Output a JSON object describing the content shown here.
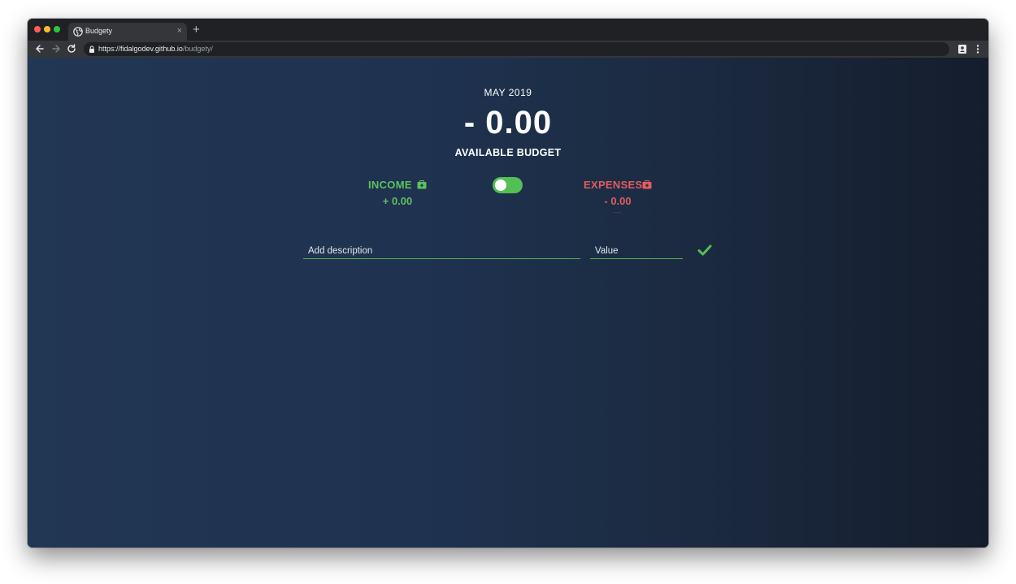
{
  "browser": {
    "tab_title": "Budgety",
    "tab_close": "×",
    "new_tab": "+",
    "url_host": "https://fidalgodev.github.io",
    "url_path": "/budgety/"
  },
  "budget": {
    "month": "MAY 2019",
    "available_value": "- 0.00",
    "available_label": "AVAILABLE BUDGET"
  },
  "income": {
    "title": "INCOME",
    "value": "+ 0.00",
    "color": "#5cc25e"
  },
  "expenses": {
    "title": "EXPENSES",
    "value": "- 0.00",
    "percentage": "---",
    "color": "#e05d5d"
  },
  "toggle": {
    "state": "on",
    "color": "#53bf55"
  },
  "form": {
    "description_placeholder": "Add description",
    "value_placeholder": "Value",
    "submit_icon": "check-icon"
  },
  "icons": {
    "income": "income-box-icon",
    "expenses": "expense-box-icon"
  }
}
